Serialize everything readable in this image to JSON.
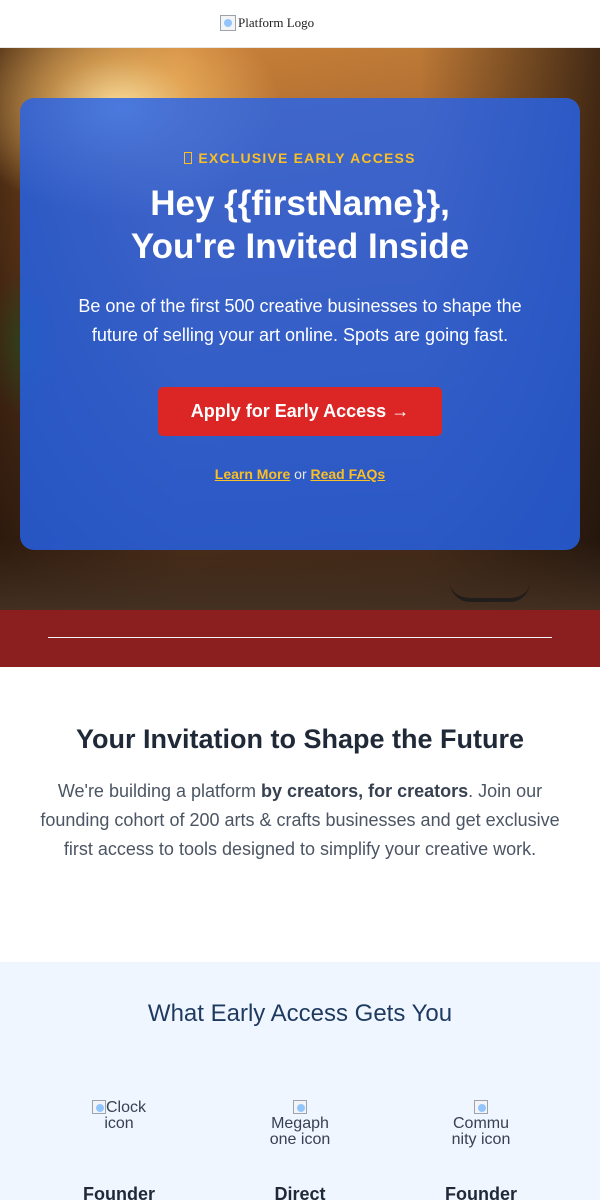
{
  "header": {
    "logo_alt": "Platform Logo"
  },
  "hero": {
    "eyebrow_icon": "broken-glyph-icon",
    "eyebrow": "EXCLUSIVE EARLY ACCESS",
    "title_line1": "Hey {{firstName}},",
    "title_line2": "You're Invited Inside",
    "subtitle": "Be one of the first 500 creative businesses to shape the future of selling your art online. Spots are going fast.",
    "cta_label": "Apply for Early Access →",
    "link_learn": "Learn More",
    "link_sep": "or",
    "link_faq": "Read FAQs"
  },
  "intro": {
    "heading": "Your Invitation to Shape the Future",
    "body_prefix": "We're building a platform ",
    "body_bold": "by creators, for creators",
    "body_suffix": ". Join our founding cohort of 200 arts & crafts businesses and get exclusive first access to tools designed to simplify your creative work."
  },
  "benefits": {
    "heading": "What Early Access Gets You",
    "features": [
      {
        "icon": "clock-icon",
        "alt": "Clock icon",
        "title": "Founder"
      },
      {
        "icon": "megaphone-icon",
        "alt": "Megaphone icon",
        "title": "Direct"
      },
      {
        "icon": "community-icon",
        "alt": "Community icon",
        "title": "Founder"
      }
    ]
  },
  "colors": {
    "card_blue": "#2563eb",
    "cta_red": "#dc2626",
    "accent_yellow": "#fbbf24",
    "band_red": "#8b1e1e",
    "benefits_bg": "#eff6ff"
  }
}
